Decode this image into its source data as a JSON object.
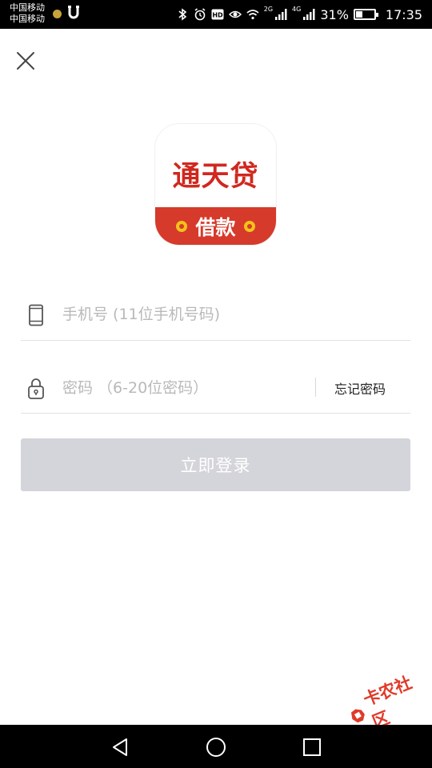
{
  "status_bar": {
    "carrier_1": "中国移动",
    "carrier_2": "中国移动",
    "net_2g": "2G",
    "net_4g": "4G",
    "battery": "31%",
    "time": "17:35"
  },
  "logo": {
    "name": "通天贷",
    "sub": "借款"
  },
  "form": {
    "phone_placeholder": "手机号 (11位手机号码)",
    "password_placeholder": "密码 （6-20位密码）",
    "forgot_label": "忘记密码",
    "login_label": "立即登录"
  },
  "watermark": {
    "text": "卡农社区"
  },
  "colors": {
    "brand_red": "#d0281f",
    "banner_red": "#d53a2a",
    "coin_yellow": "#f2c21a",
    "button_disabled": "#d4d4db"
  },
  "icons": [
    "close-icon",
    "phone-icon",
    "lock-icon",
    "back-icon",
    "home-icon",
    "recent-apps-icon"
  ]
}
